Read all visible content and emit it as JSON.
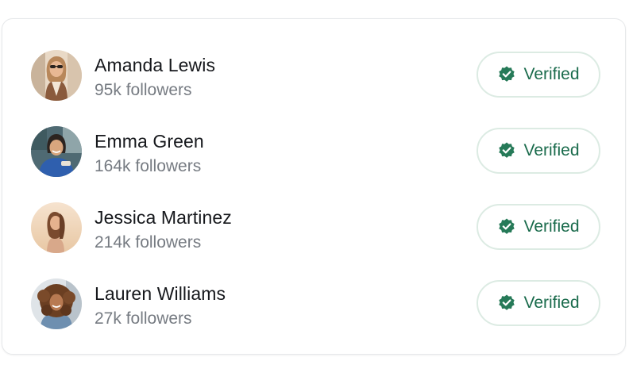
{
  "accent_color": "#1a6b4c",
  "users": [
    {
      "name": "Amanda Lewis",
      "followers": "95k followers",
      "status": "Verified",
      "icon": "verified-badge-icon"
    },
    {
      "name": "Emma Green",
      "followers": "164k followers",
      "status": "Verified",
      "icon": "verified-badge-icon"
    },
    {
      "name": "Jessica Martinez",
      "followers": "214k followers",
      "status": "Verified",
      "icon": "verified-badge-icon"
    },
    {
      "name": "Lauren Williams",
      "followers": "27k followers",
      "status": "Verified",
      "icon": "verified-badge-icon"
    }
  ]
}
